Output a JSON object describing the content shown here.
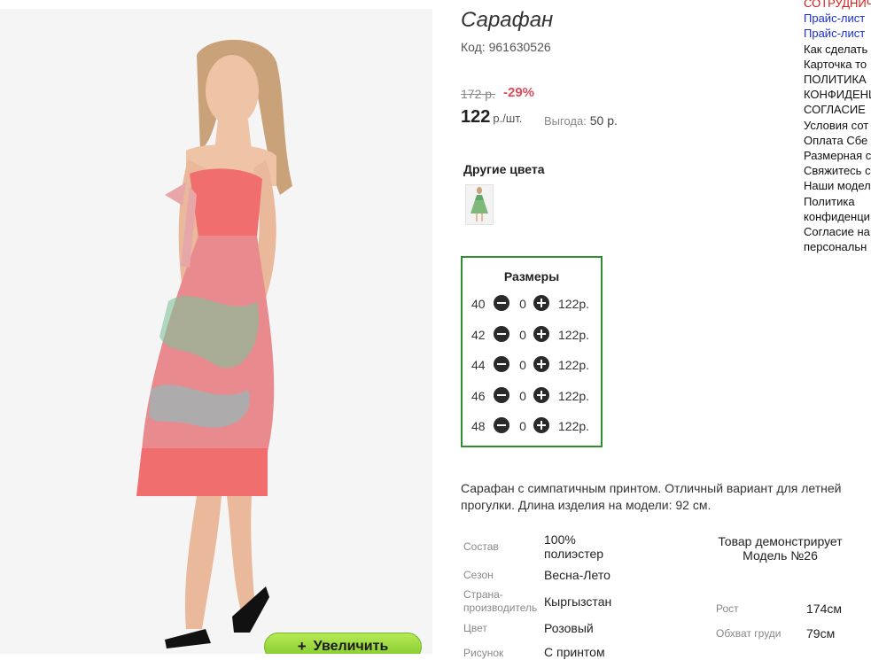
{
  "product": {
    "title": "Сарафан",
    "code_label": "Код: 961630526",
    "old_price": "172 р.",
    "discount": "-29%",
    "price": "122",
    "price_unit": "р./шт.",
    "savings_label": "Выгода:",
    "savings_value": "50 р.",
    "zoom_plus": "+",
    "zoom_label": "Увеличить"
  },
  "colors": {
    "title": "Другие цвета"
  },
  "sizes": {
    "title": "Размеры",
    "rows": [
      {
        "size": "40",
        "qty": "0",
        "price": "122р."
      },
      {
        "size": "42",
        "qty": "0",
        "price": "122р."
      },
      {
        "size": "44",
        "qty": "0",
        "price": "122р."
      },
      {
        "size": "46",
        "qty": "0",
        "price": "122р."
      },
      {
        "size": "48",
        "qty": "0",
        "price": "122р."
      }
    ]
  },
  "description": "Сарафан с симпатичным принтом. Отличный вариант для летней прогулки. Длина изделия на модели: 92 см.",
  "specs": [
    {
      "label": "Состав",
      "value": "100% полиэстер"
    },
    {
      "label": "Сезон",
      "value": "Весна-Лето"
    },
    {
      "label": "Страна-производитель",
      "value": "Кыргызстан"
    },
    {
      "label": "Цвет",
      "value": "Розовый"
    },
    {
      "label": "Рисунок",
      "value": "С принтом"
    }
  ],
  "model": {
    "note": "Товар демонстрирует Модель №26",
    "params": [
      {
        "label": "Рост",
        "value": "174см"
      },
      {
        "label": "Обхват груди",
        "value": "79см"
      }
    ]
  },
  "side_links": [
    {
      "text": "СОТРУДНИЧЕСТВО",
      "color": "#d91a1a"
    },
    {
      "text": "Прайс-лист",
      "color": "#1a2ecc"
    },
    {
      "text": "Прайс-лист",
      "color": "#1a2ecc"
    },
    {
      "text": "Как сделать",
      "color": "#111111"
    },
    {
      "text": "Карточка то",
      "color": "#111111"
    },
    {
      "text": "ПОЛИТИКА",
      "color": "#111111"
    },
    {
      "text": "КОНФИДЕНЦИ",
      "color": "#111111"
    },
    {
      "text": "СОГЛАСИЕ",
      "color": "#111111"
    },
    {
      "text": "Условия сот",
      "color": "#111111"
    },
    {
      "text": "Оплата Сбе",
      "color": "#111111"
    },
    {
      "text": "Размерная с",
      "color": "#111111"
    },
    {
      "text": "Свяжитесь с",
      "color": "#111111"
    },
    {
      "text": "Наши модел",
      "color": "#111111"
    },
    {
      "text": "Политика",
      "color": "#111111"
    },
    {
      "text": "конфиденци",
      "color": "#111111"
    },
    {
      "text": "Согласие на",
      "color": "#111111"
    },
    {
      "text": "персональн",
      "color": "#111111"
    }
  ],
  "theme": {
    "discount_color": "#e04a5c",
    "size_box_border": "#2f8f2f",
    "zoom_button": "#8fd43a"
  }
}
